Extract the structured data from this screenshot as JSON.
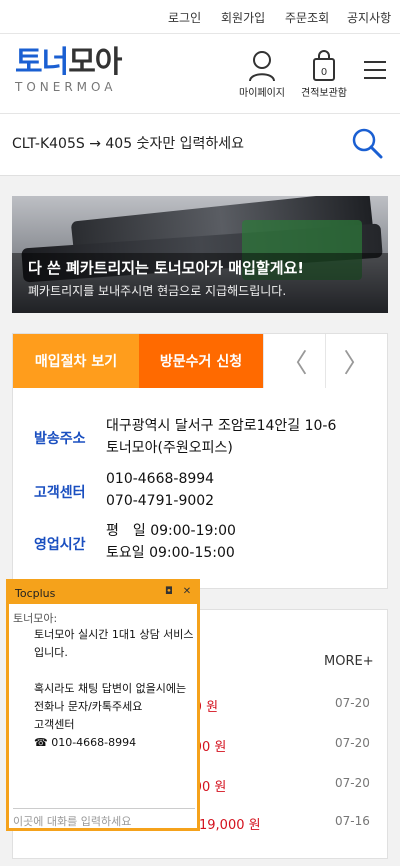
{
  "topnav": {
    "login": "로그인",
    "signup": "회원가입",
    "order_lookup": "주문조회",
    "notice": "공지사항"
  },
  "header": {
    "logo_part1": "토너",
    "logo_part2": "모아",
    "logo_sub": "TONERMOA",
    "mypage_label": "마이페이지",
    "cart_label": "견적보관함",
    "cart_count": "0",
    "icons": [
      "user-icon",
      "bag-icon",
      "menu-icon"
    ]
  },
  "search": {
    "placeholder": "CLT-K405S → 405 숫자만 입력하세요",
    "icon": "search-icon"
  },
  "banner": {
    "title": "다 쓴 폐카트리지는 토너모아가 매입할게요!",
    "subtitle": "폐카트리지를 보내주시면 현금으로 지급해드립니다."
  },
  "tabs": {
    "procedure": "매입절차 보기",
    "pickup": "방문수거 신청",
    "prev_arrow": "〈",
    "next_arrow": "〉"
  },
  "info": {
    "address_label": "발송주소",
    "address_line1": "대구광역시 달서구 조암로14안길 10-6",
    "address_line2": "토너모아(주원오피스)",
    "cs_label": "고객센터",
    "cs_phone1": "010-4668-8994",
    "cs_phone2": "070-4791-9002",
    "hours_label": "영업시간",
    "hours_weekday": "평　일 09:00-19:00",
    "hours_sat": "토요일 09:00-15:00"
  },
  "list": {
    "more": "MORE+",
    "items": [
      {
        "price": ",000 원",
        "date": "07-20"
      },
      {
        "price": "0,000 원",
        "date": "07-20"
      },
      {
        "price": "0,000 원",
        "date": "07-20"
      },
      {
        "price": "19,000 원",
        "date": "07-16"
      }
    ]
  },
  "chat": {
    "title": "Tocplus",
    "sender": "토너모아:",
    "message": "토너모아 실시간 1대1 상담 서비스입니다.\n\n혹시라도 채팅 답변이 없을시에는\n전화나 문자/카톡주세요\n고객센터\n☎ 010-4668-8994",
    "input_placeholder": "이곳에 대화를 입력하세요",
    "minimize_symbol": "◘",
    "close_symbol": "✕"
  },
  "colors": {
    "brand_blue": "#1a5fd2",
    "tab_orange_light": "#ff9d1c",
    "tab_orange": "#ff6a00",
    "price_red": "#d4121e",
    "chat_orange": "#f5a21b"
  }
}
